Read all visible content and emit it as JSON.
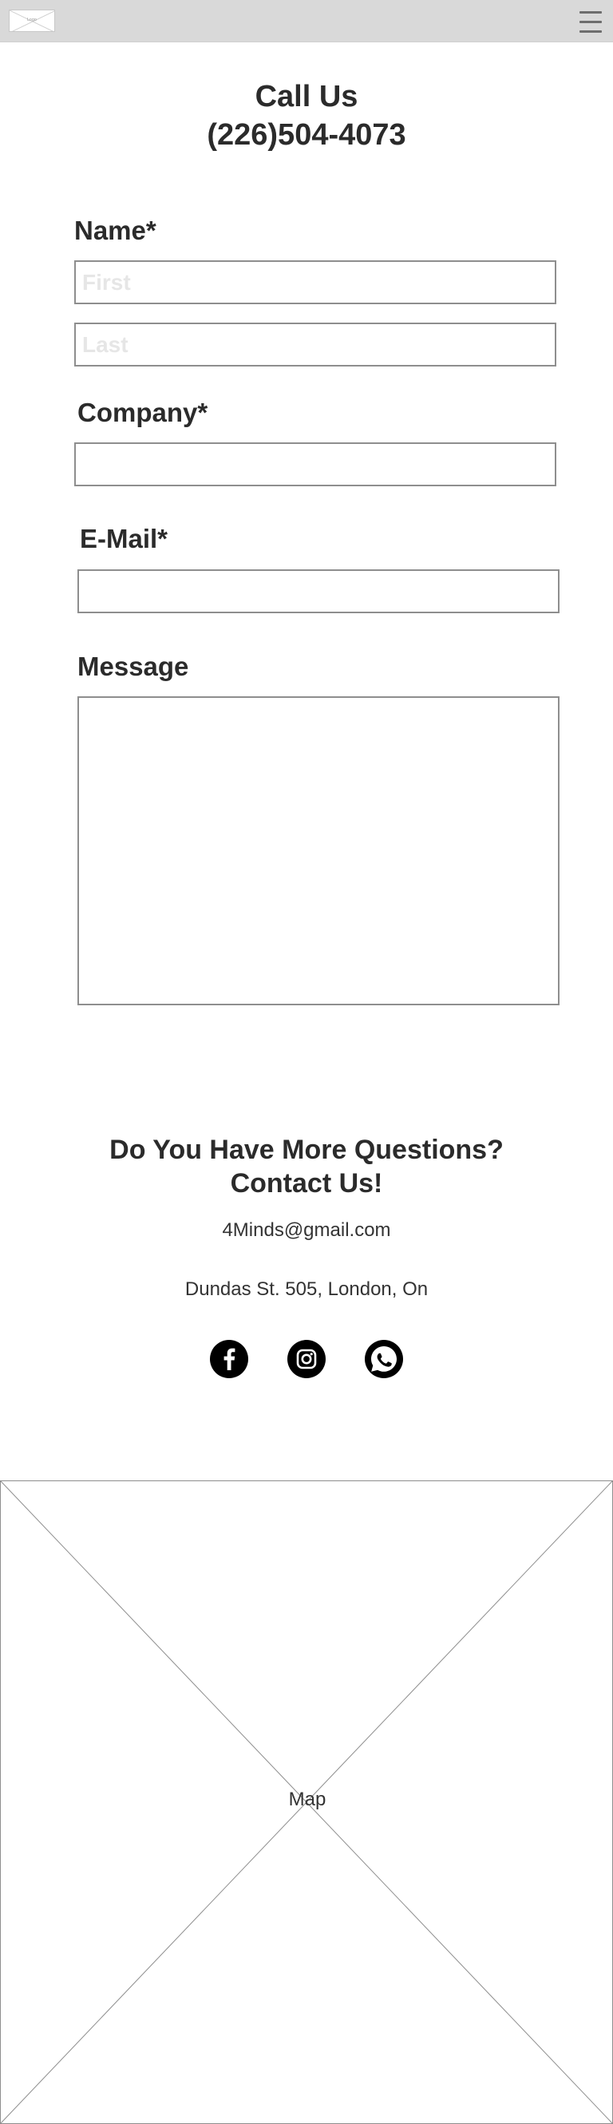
{
  "header": {
    "logo_text": "Logo",
    "menu_icon": "hamburger-icon"
  },
  "call_us": {
    "title": "Call Us",
    "phone": "(226)504-4073"
  },
  "form": {
    "name_label": "Name*",
    "first_placeholder": "First",
    "last_placeholder": "Last",
    "company_label": "Company*",
    "email_label": "E-Mail*",
    "message_label": "Message"
  },
  "contact": {
    "line1": "Do You Have More Questions?",
    "line2": "Contact Us!",
    "email": "4Minds@gmail.com",
    "address": "Dundas St. 505, London, On"
  },
  "social": [
    {
      "icon": "facebook-icon"
    },
    {
      "icon": "instagram-icon"
    },
    {
      "icon": "whatsapp-icon"
    }
  ],
  "map": {
    "label": "Map"
  }
}
